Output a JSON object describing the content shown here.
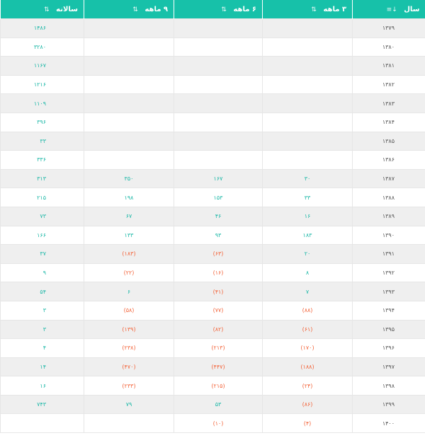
{
  "columns": [
    {
      "label": "سال",
      "sort_icon": "sort-numeric-icon"
    },
    {
      "label": "۳ ماهه",
      "sort_icon": "sort-icon"
    },
    {
      "label": "۶ ماهه",
      "sort_icon": "sort-icon"
    },
    {
      "label": "۹ ماهه",
      "sort_icon": "sort-icon"
    },
    {
      "label": "سالانه",
      "sort_icon": "sort-icon"
    }
  ],
  "sort_glyphs": {
    "year": "↓≡",
    "other": "⇅"
  },
  "colors": {
    "header_bg": "#17c1a9",
    "positive": "#1ab7a6",
    "negative": "#f3643a",
    "stripe": "#efefef"
  },
  "rows": [
    {
      "year": "۱۳۷۹",
      "q3": "",
      "q6": "",
      "q9": "",
      "annual": "۱۴۸۶"
    },
    {
      "year": "۱۳۸۰",
      "q3": "",
      "q6": "",
      "q9": "",
      "annual": "۳۲۸۰"
    },
    {
      "year": "۱۳۸۱",
      "q3": "",
      "q6": "",
      "q9": "",
      "annual": "۱۱۶۷"
    },
    {
      "year": "۱۳۸۲",
      "q3": "",
      "q6": "",
      "q9": "",
      "annual": "۱۲۱۶"
    },
    {
      "year": "۱۳۸۳",
      "q3": "",
      "q6": "",
      "q9": "",
      "annual": "۱۱۰۹"
    },
    {
      "year": "۱۳۸۴",
      "q3": "",
      "q6": "",
      "q9": "",
      "annual": "۳۹۶"
    },
    {
      "year": "۱۳۸۵",
      "q3": "",
      "q6": "",
      "q9": "",
      "annual": "۳۳"
    },
    {
      "year": "۱۳۸۶",
      "q3": "",
      "q6": "",
      "q9": "",
      "annual": "۳۳۶"
    },
    {
      "year": "۱۳۸۷",
      "q3": "۳۰",
      "q6": "۱۶۷",
      "q9": "۳۵۰",
      "annual": "۳۱۳"
    },
    {
      "year": "۱۳۸۸",
      "q3": "۳۳",
      "q6": "۱۵۳",
      "q9": "۱۹۸",
      "annual": "۲۱۵"
    },
    {
      "year": "۱۳۸۹",
      "q3": "۱۶",
      "q6": "۴۶",
      "q9": "۶۷",
      "annual": "۷۳"
    },
    {
      "year": "۱۳۹۰",
      "q3": "۱۸۳",
      "q6": "۹۳",
      "q9": "۱۳۳",
      "annual": "۱۶۶"
    },
    {
      "year": "۱۳۹۱",
      "q3": "۲۰",
      "q6": "(۶۳)",
      "q9": "(۱۸۳)",
      "annual": "۳۷"
    },
    {
      "year": "۱۳۹۲",
      "q3": "۸",
      "q6": "(۱۶)",
      "q9": "(۲۲)",
      "annual": "۹"
    },
    {
      "year": "۱۳۹۳",
      "q3": "۷",
      "q6": "(۴۱)",
      "q9": "۶",
      "annual": "۵۴"
    },
    {
      "year": "۱۳۹۴",
      "q3": "(۸۸)",
      "q6": "(۷۷)",
      "q9": "(۵۸)",
      "annual": "۳"
    },
    {
      "year": "۱۳۹۵",
      "q3": "(۶۱)",
      "q6": "(۸۲)",
      "q9": "(۱۳۹)",
      "annual": "۳"
    },
    {
      "year": "۱۳۹۶",
      "q3": "(۱۷۰)",
      "q6": "(۲۱۳)",
      "q9": "(۲۳۸)",
      "annual": "۴"
    },
    {
      "year": "۱۳۹۷",
      "q3": "(۱۸۸)",
      "q6": "(۴۴۷)",
      "q9": "(۴۷۰)",
      "annual": "۱۴"
    },
    {
      "year": "۱۳۹۸",
      "q3": "(۲۴)",
      "q6": "(۲۱۵)",
      "q9": "(۲۳۳)",
      "annual": "۱۶"
    },
    {
      "year": "۱۳۹۹",
      "q3": "(۸۶)",
      "q6": "۵۳",
      "q9": "۷۹",
      "annual": "۷۴۳"
    },
    {
      "year": "۱۴۰۰",
      "q3": "(۴)",
      "q6": "(۱۰)",
      "q9": "",
      "annual": ""
    }
  ]
}
